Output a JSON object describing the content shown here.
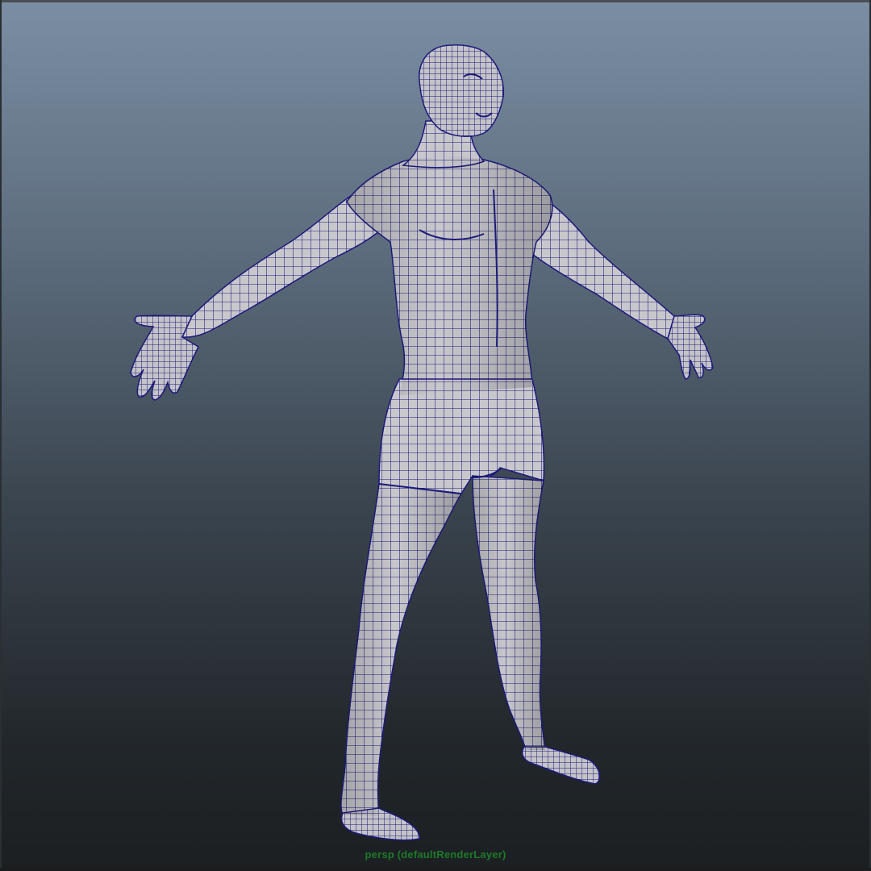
{
  "viewport": {
    "camera_label": "persp (defaultRenderLayer)",
    "panel_name": "persp",
    "background_top": "#7b8ea3",
    "background_bottom": "#1b1f22"
  },
  "model": {
    "display_mode": "wireframe-on-shaded",
    "surface_color": "#c9c8cc",
    "wire_color": "#1c1a7a"
  }
}
